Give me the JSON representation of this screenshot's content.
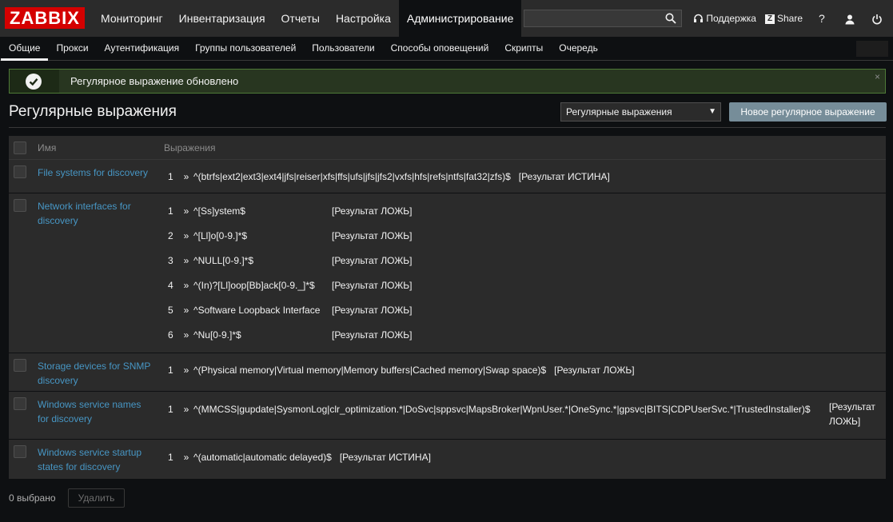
{
  "logo": "ZABBIX",
  "main_nav": [
    "Мониторинг",
    "Инвентаризация",
    "Отчеты",
    "Настройка",
    "Администрирование"
  ],
  "search": {
    "value": "",
    "placeholder": ""
  },
  "tools": {
    "support": "Поддержка",
    "share": "Share",
    "help": "?"
  },
  "sub_nav": [
    "Общие",
    "Прокси",
    "Аутентификация",
    "Группы пользователей",
    "Пользователи",
    "Способы оповещений",
    "Скрипты",
    "Очередь"
  ],
  "message": {
    "text": "Регулярное выражение обновлено",
    "close": "×"
  },
  "page_title": "Регулярные выражения",
  "select": {
    "value": "Регулярные выражения"
  },
  "new_button": "Новое регулярное выражение",
  "table": {
    "headers": {
      "name": "Имя",
      "expressions": "Выражения"
    },
    "rows": [
      {
        "name": "File systems for discovery",
        "expressions": [
          {
            "n": "1",
            "expr": "^(btrfs|ext2|ext3|ext4|jfs|reiser|xfs|ffs|ufs|jfs|jfs2|vxfs|hfs|refs|ntfs|fat32|zfs)$",
            "result": "[Результат ИСТИНА]"
          }
        ]
      },
      {
        "name": "Network interfaces for discovery",
        "expressions": [
          {
            "n": "1",
            "expr": "^[Ss]ystem$",
            "result": "[Результат ЛОЖЬ]"
          },
          {
            "n": "2",
            "expr": "^[Ll]o[0-9.]*$",
            "result": "[Результат ЛОЖЬ]"
          },
          {
            "n": "3",
            "expr": "^NULL[0-9.]*$",
            "result": "[Результат ЛОЖЬ]"
          },
          {
            "n": "4",
            "expr": "^(In)?[Ll]oop[Bb]ack[0-9._]*$",
            "result": "[Результат ЛОЖЬ]"
          },
          {
            "n": "5",
            "expr": "^Software Loopback Interface",
            "result": "[Результат ЛОЖЬ]"
          },
          {
            "n": "6",
            "expr": "^Nu[0-9.]*$",
            "result": "[Результат ЛОЖЬ]"
          }
        ]
      },
      {
        "name": "Storage devices for SNMP discovery",
        "expressions": [
          {
            "n": "1",
            "expr": "^(Physical memory|Virtual memory|Memory buffers|Cached memory|Swap space)$",
            "result": "[Результат ЛОЖЬ]"
          }
        ]
      },
      {
        "name": "Windows service names for discovery",
        "expressions": [
          {
            "n": "1",
            "expr": "^(MMCSS|gupdate|SysmonLog|clr_optimization.*|DoSvc|sppsvc|MapsBroker|WpnUser.*|OneSync.*|gpsvc|BITS|CDPUserSvc.*|TrustedInstaller)$",
            "result": "[Результат ЛОЖЬ]"
          }
        ]
      },
      {
        "name": "Windows service startup states for discovery",
        "expressions": [
          {
            "n": "1",
            "expr": "^(automatic|automatic delayed)$",
            "result": "[Результат ИСТИНА]"
          }
        ]
      }
    ]
  },
  "arrow": "»",
  "footer": {
    "selected": "0 выбрано",
    "delete": "Удалить"
  },
  "colors": {
    "brand": "#d40000",
    "link": "#4796c4",
    "button": "#768d99",
    "success_border": "#4e7a37"
  },
  "icons": [
    "search-icon",
    "headset-icon",
    "share-icon",
    "help-icon",
    "user-icon",
    "power-icon",
    "check-icon",
    "close-icon"
  ]
}
